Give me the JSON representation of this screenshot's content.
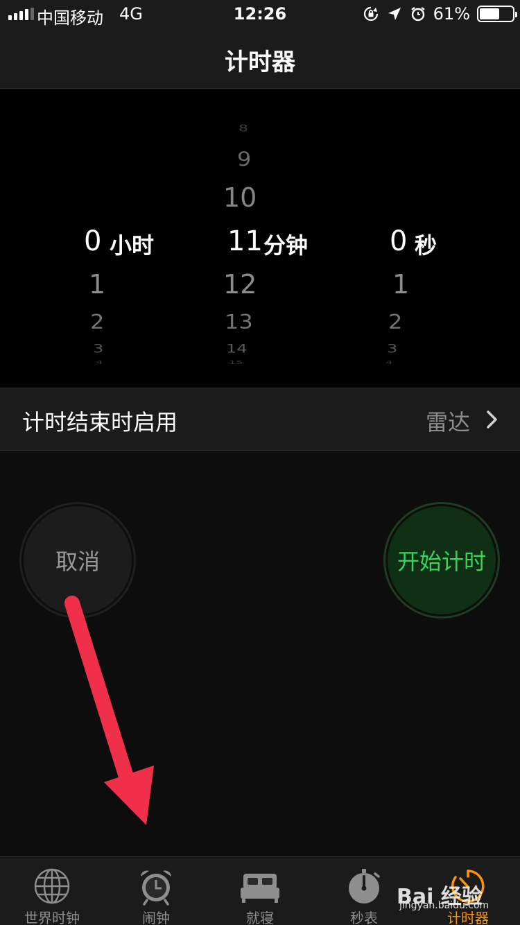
{
  "status_bar": {
    "carrier": "中国移动",
    "network": "4G",
    "time": "12:26",
    "battery_percent": "61%",
    "battery_level": 0.61,
    "icons": [
      "orientation-lock-icon",
      "location-arrow-icon",
      "alarm-icon"
    ]
  },
  "nav": {
    "title": "计时器"
  },
  "picker": {
    "hours": {
      "above": [],
      "selected": "0",
      "unit": "小时",
      "below": [
        "1",
        "2",
        "3",
        "4"
      ]
    },
    "minutes": {
      "above": [
        "8",
        "9",
        "10"
      ],
      "selected": "11",
      "unit": "分钟",
      "below": [
        "12",
        "13",
        "14",
        "15"
      ]
    },
    "seconds": {
      "above": [],
      "selected": "0",
      "unit": "秒",
      "below": [
        "1",
        "2",
        "3",
        "4"
      ]
    }
  },
  "sound_row": {
    "label": "计时结束时启用",
    "value": "雷达"
  },
  "buttons": {
    "cancel": "取消",
    "start": "开始计时"
  },
  "annotation": {
    "color": "#f0304a"
  },
  "tabs": [
    {
      "label": "世界时钟",
      "icon": "globe-icon",
      "active": false
    },
    {
      "label": "闹钟",
      "icon": "alarm-clock-icon",
      "active": false
    },
    {
      "label": "就寝",
      "icon": "bed-icon",
      "active": false
    },
    {
      "label": "秒表",
      "icon": "stopwatch-icon",
      "active": false
    },
    {
      "label": "计时器",
      "icon": "timer-icon",
      "active": true
    }
  ],
  "colors": {
    "accent": "#ff9500",
    "start_text": "#35d65a",
    "start_bg": "#0f3015"
  },
  "watermark": {
    "brand": "Bai 经验",
    "url": "jingyan.baidu.com"
  }
}
